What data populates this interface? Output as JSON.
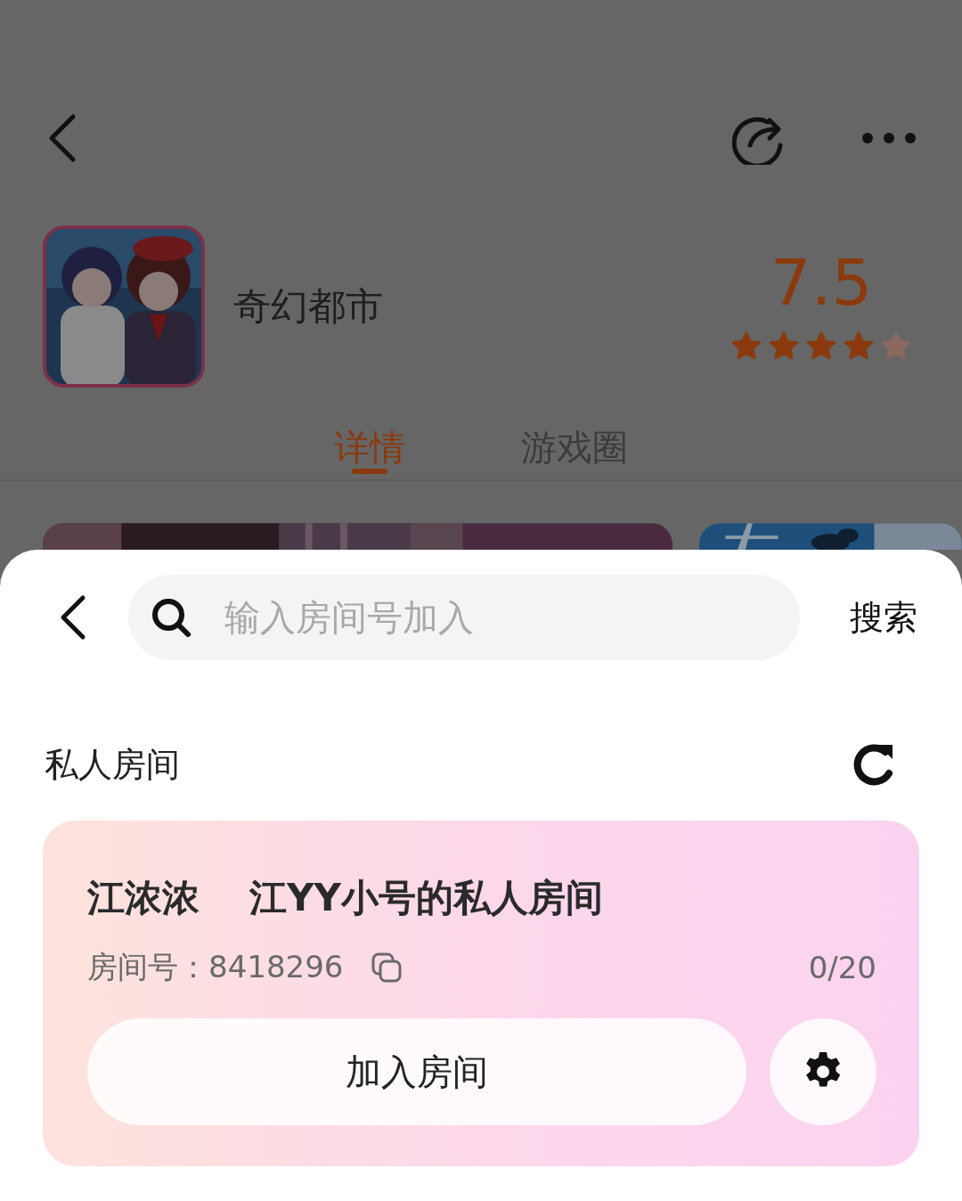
{
  "game": {
    "title": "奇幻都市",
    "score": "7.5",
    "stars": 4
  },
  "tabs": [
    {
      "label": "详情",
      "selected": true
    },
    {
      "label": "游戏圈",
      "selected": false
    }
  ],
  "sheet": {
    "search": {
      "placeholder": "输入房间号加入",
      "button": "搜索"
    },
    "section_title": "私人房间",
    "rooms": [
      {
        "owner": "江浓浓",
        "name": "江YY小号的私人房间",
        "room_number": "房间号：8418296",
        "occupancy": "0/20",
        "join_button": "加入房间"
      }
    ]
  }
}
